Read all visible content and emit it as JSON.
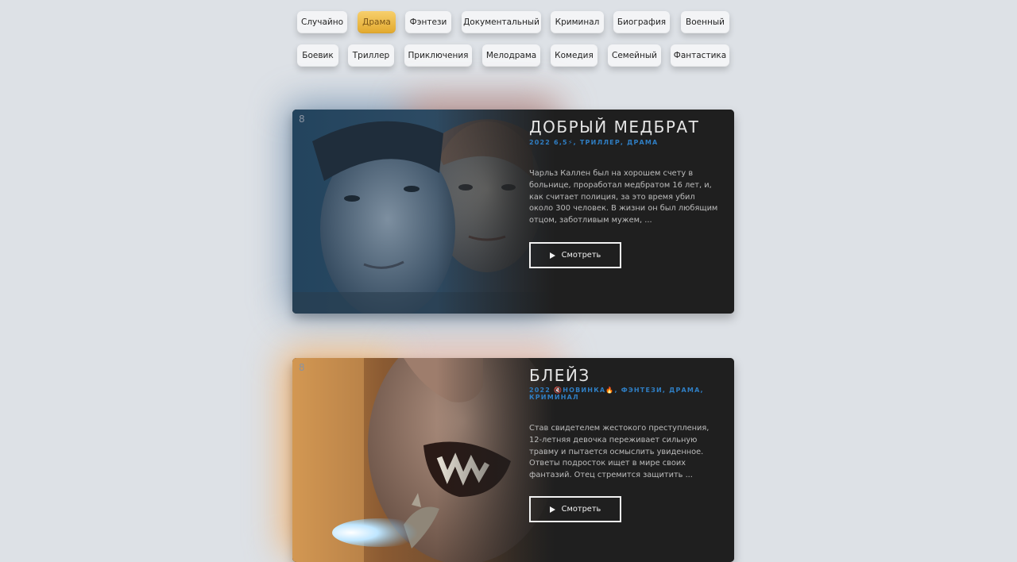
{
  "genres_row1": [
    {
      "label": "Случайно",
      "active": false
    },
    {
      "label": "Драма",
      "active": true
    },
    {
      "label": "Фэнтези",
      "active": false
    },
    {
      "label": "Документальный",
      "active": false
    },
    {
      "label": "Криминал",
      "active": false
    },
    {
      "label": "Биография",
      "active": false
    },
    {
      "label": "Военный",
      "active": false
    }
  ],
  "genres_row2": [
    {
      "label": "Боевик",
      "active": false
    },
    {
      "label": "Триллер",
      "active": false
    },
    {
      "label": "Приключения",
      "active": false
    },
    {
      "label": "Мелодрама",
      "active": false
    },
    {
      "label": "Комедия",
      "active": false
    },
    {
      "label": "Семейный",
      "active": false
    },
    {
      "label": "Фантастика",
      "active": false
    }
  ],
  "movies": [
    {
      "rank": "8",
      "title": "ДОБРЫЙ МЕДБРАТ",
      "meta": "2022 6,5⚡, ТРИЛЛЕР, ДРАМА",
      "description": "Чарльз Каллен был на хорошем счету в больнице, проработал медбратом 16 лет, и, как считает полиция, за это время убил около 300 человек. В жизни он был любящим отцом, заботливым мужем, ...",
      "watch_label": "Смотреть"
    },
    {
      "rank": "8",
      "title": "БЛЕЙЗ",
      "meta": "2022 🔇НОВИНКА🔥, ФЭНТЕЗИ, ДРАМА, КРИМИНАЛ",
      "description": "Став свидетелем жестокого преступления, 12-летняя девочка переживает сильную травму и пытается осмыслить увиденное. Ответы подросток ищет в мире своих фантазий. Отец стремится защитить ...",
      "watch_label": "Смотреть"
    }
  ],
  "colors": {
    "background": "#dde1e6",
    "active_pill": "#e8b13a",
    "accent_blue": "#2f7ec3",
    "card_bg": "#1f1f1f"
  }
}
